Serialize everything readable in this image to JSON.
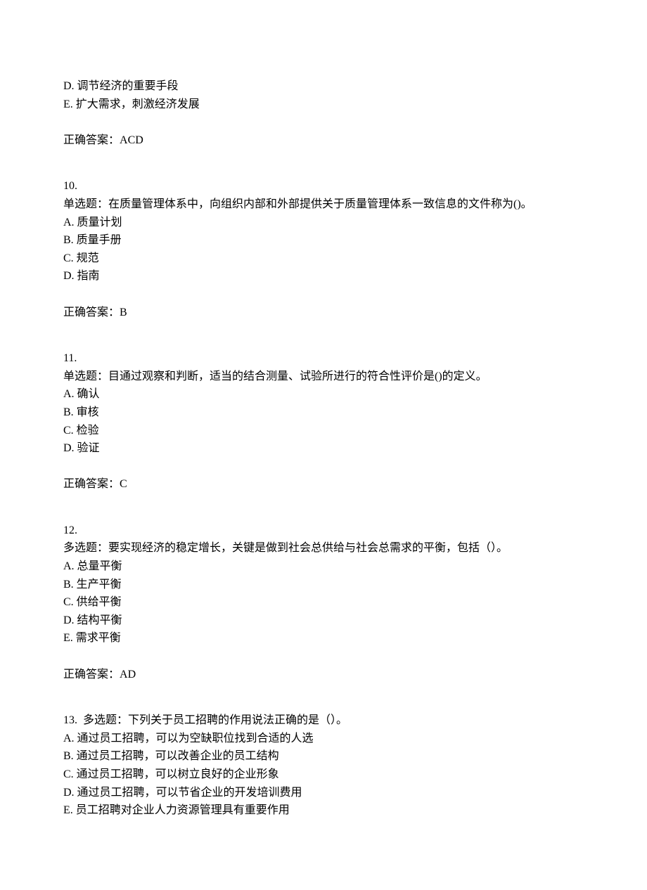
{
  "q9_partial": {
    "optionD": "D. 调节经济的重要手段",
    "optionE": "E. 扩大需求，刺激经济发展",
    "answer_label": "正确答案：",
    "answer_value": "ACD"
  },
  "q10": {
    "number": "10.",
    "stem": "单选题：在质量管理体系中，向组织内部和外部提供关于质量管理体系一致信息的文件称为()。",
    "optionA": "A. 质量计划",
    "optionB": "B. 质量手册",
    "optionC": "C. 规范",
    "optionD": "D. 指南",
    "answer_label": "正确答案：",
    "answer_value": "B"
  },
  "q11": {
    "number": "11.",
    "stem": "单选题：目通过观察和判断，适当的结合测量、试验所进行的符合性评价是()的定义。",
    "optionA": "A. 确认",
    "optionB": "B. 审核",
    "optionC": "C. 检验",
    "optionD": "D. 验证",
    "answer_label": "正确答案：",
    "answer_value": "C"
  },
  "q12": {
    "number": "12.",
    "stem": "多选题：要实现经济的稳定增长，关键是做到社会总供给与社会总需求的平衡，包括（）。",
    "optionA": "A. 总量平衡",
    "optionB": "B. 生产平衡",
    "optionC": "C. 供给平衡",
    "optionD": "D. 结构平衡",
    "optionE": "E. 需求平衡",
    "answer_label": "正确答案：",
    "answer_value": "AD"
  },
  "q13": {
    "number_stem": "13.  多选题：下列关于员工招聘的作用说法正确的是（）。",
    "optionA": "A. 通过员工招聘，可以为空缺职位找到合适的人选",
    "optionB": "B. 通过员工招聘，可以改善企业的员工结构",
    "optionC": "C. 通过员工招聘，可以树立良好的企业形象",
    "optionD": "D. 通过员工招聘，可以节省企业的开发培训费用",
    "optionE": "E. 员工招聘对企业人力资源管理具有重要作用"
  }
}
